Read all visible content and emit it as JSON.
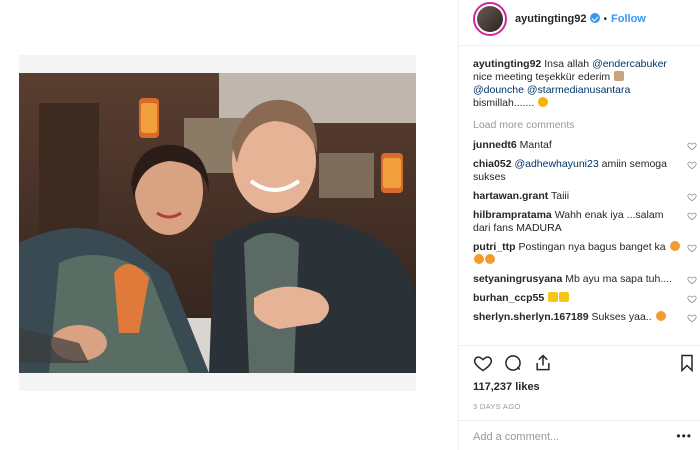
{
  "header": {
    "username": "ayutingting92",
    "separator": "•",
    "follow_label": "Follow"
  },
  "caption": {
    "username": "ayutingting92",
    "text_1": "Insa allah",
    "mention_1": "@endercabuker",
    "text_2": "nice meeting teşekkür ederim",
    "mention_2": "@dounche",
    "mention_3": "@starmedianusantara",
    "text_3": "bismillah......."
  },
  "load_more": "Load more comments",
  "comments": [
    {
      "user": "junnedt6",
      "text": "Mantaf"
    },
    {
      "user": "chia052",
      "mention": "@adhewhayuni23",
      "text": "amiin semoga sukses"
    },
    {
      "user": "hartawan.grant",
      "text": "Taiii"
    },
    {
      "user": "hilbrampratama",
      "text": "Wahh enak iya ...salam dari fans MADURA"
    },
    {
      "user": "putri_ttp",
      "text": "Postingan nya bagus banget ka"
    },
    {
      "user": "setyaningrusyana",
      "text": "Mb ayu ma sapa tuh...."
    },
    {
      "user": "burhan_ccp55",
      "text": ""
    },
    {
      "user": "sherlyn.sherlyn.167189",
      "text": "Sukses yaa.."
    }
  ],
  "likes": "117,237 likes",
  "timestamp": "3 DAYS AGO",
  "add_comment_placeholder": "Add a comment...",
  "more_options": "•••",
  "colors": {
    "link": "#003569",
    "accent": "#3897f0",
    "muted": "#999999"
  }
}
